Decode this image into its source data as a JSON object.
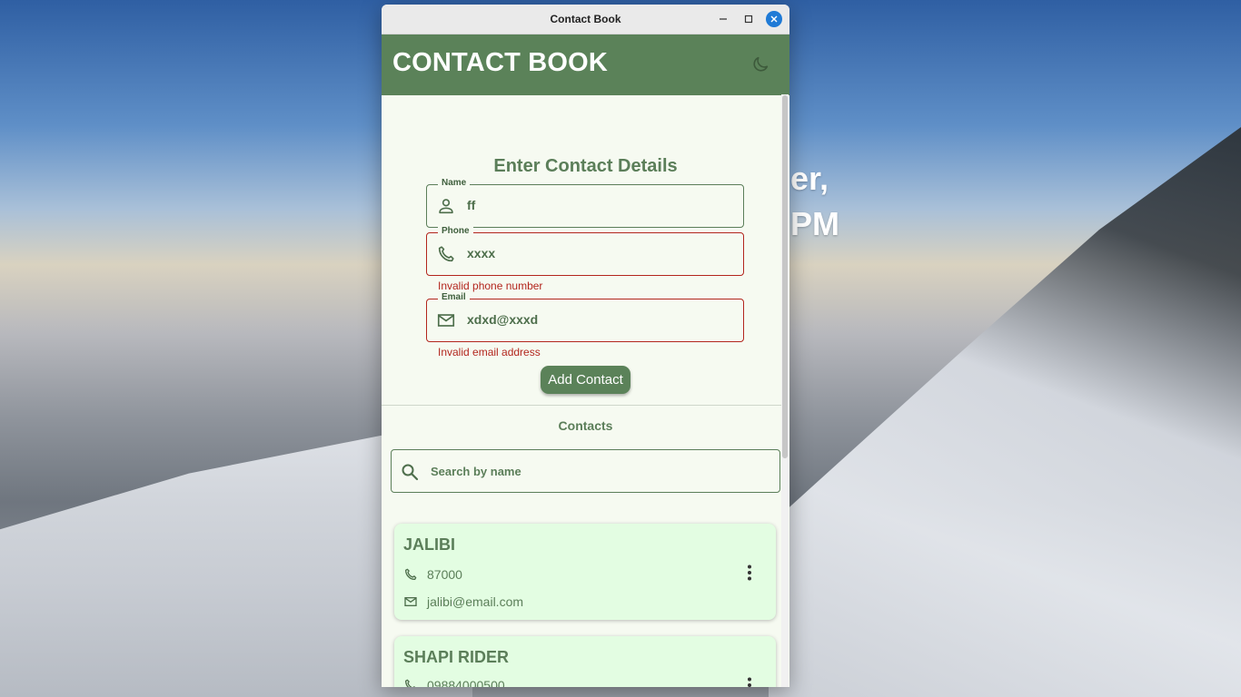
{
  "background": {
    "line1": "er,",
    "line2": "PM"
  },
  "window": {
    "title": "Contact Book"
  },
  "appbar": {
    "title": "CONTACT BOOK",
    "theme_toggle_icon": "moon-icon"
  },
  "form": {
    "title": "Enter Contact Details",
    "fields": [
      {
        "label": "Name",
        "value": "ff",
        "icon": "person-icon",
        "error": ""
      },
      {
        "label": "Phone",
        "value": "xxxx",
        "icon": "phone-icon",
        "error": "Invalid phone number"
      },
      {
        "label": "Email",
        "value": "xdxd@xxxd",
        "icon": "mail-icon",
        "error": "Invalid email address"
      }
    ],
    "submit_label": "Add Contact"
  },
  "contacts": {
    "title": "Contacts",
    "search_placeholder": "Search by name",
    "items": [
      {
        "name": "JALIBI",
        "phone": "87000",
        "email": "jalibi@email.com"
      },
      {
        "name": "SHAPI RIDER",
        "phone": "09884000500",
        "email": ""
      }
    ]
  },
  "colors": {
    "primary": "#5b8259",
    "surface": "#f6faf1",
    "card": "#e3fde2",
    "error": "#b3261e"
  }
}
